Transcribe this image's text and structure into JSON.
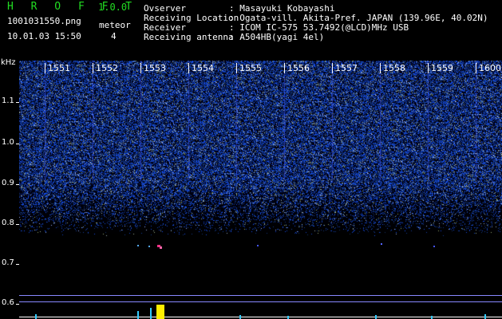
{
  "header": {
    "app_title": "H R O F F T",
    "version": "1.0.0",
    "filename": "1001031550.png",
    "datetime": "10.01.03 15:50",
    "meteor_label": "meteor",
    "meteor_count": "4"
  },
  "info": [
    {
      "label": "Ovserver",
      "value": ": Masayuki Kobayashi"
    },
    {
      "label": "Receiving Location",
      "value": ": Ogata-vill. Akita-Pref. JAPAN (139.96E, 40.02N)"
    },
    {
      "label": "Receiver",
      "value": ": ICOM IC-575 53.7492(@LCD)MHz USB"
    },
    {
      "label": "Receiving antenna",
      "value": ": A504HB(yagi 4el)"
    }
  ],
  "freq_axis": {
    "unit": "kHz",
    "labels": [
      "1.1",
      "1.0",
      "0.9",
      "0.8",
      "0.7",
      "0.6"
    ]
  },
  "time_axis": {
    "labels": [
      "1551",
      "1552",
      "1553",
      "1554",
      "1555",
      "1556",
      "1557",
      "1558",
      "1559",
      "1600"
    ]
  },
  "colors": {
    "noise": "#2233cc",
    "title_green": "#22dd22",
    "meteor": "#ff3388",
    "signal_bar": "#ffee00",
    "baseline": "#ffffff",
    "marker_line": "#8888ff"
  }
}
